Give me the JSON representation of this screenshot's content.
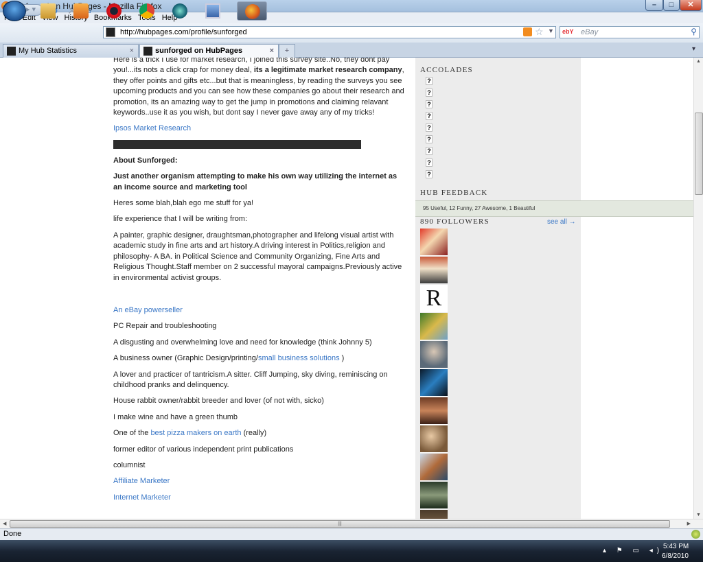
{
  "window": {
    "title": "sunforged on HubPages - Mozilla Firefox",
    "min_label": "–",
    "max_label": "□",
    "close_label": "✕"
  },
  "menu": [
    "File",
    "Edit",
    "View",
    "History",
    "Bookmarks",
    "Tools",
    "Help"
  ],
  "nav": {
    "url": "http://hubpages.com/profile/sunforged",
    "search_placeholder": "eBay",
    "search_engine": "ebY"
  },
  "tabs": [
    {
      "label": "My Hub Statistics",
      "active": false
    },
    {
      "label": "sunforged on HubPages",
      "active": true
    }
  ],
  "profile": {
    "intro_a": "Here is a trick I use for market research, I joined this survey site..No, they dont pay you!...its nots a click crap for money deal, ",
    "intro_bold": "its a legitimate market research company",
    "intro_b": ", they offer points and gifts etc...but that is meaningless, by reading the surveys you see upcoming products and you can see how these companies go about their research and promotion, its an amazing way to get the jump in promotions and claiming relavant keywords..use it as you wish, but dont say I never gave away any of my tricks!",
    "ipsos_link": "Ipsos Market Research",
    "about_heading": "About Sunforged:",
    "tagline": "Just another organism attempting to make his own way utilizing the internet as an income source and marketing tool",
    "blah": "Heres some blah,blah ego me stuff for ya!",
    "experience": "life experience that I will be writing from:",
    "bio": "A painter, graphic designer, draughtsman,photographer and lifelong visual artist with academic study in fine arts and art history.A driving interest in Politics,religion and philosophy- A BA. in Political Science and Community Organizing, Fine Arts and Religious Thought.Staff member on 2 successful mayoral campaigns.Previously active in environmental activist groups.",
    "ebay_link": "An eBay powerseller",
    "pc_repair": "PC Repair and troubleshooting",
    "knowledge": "A disgusting and overwhelming love and need for knowledge (think Johnny 5)",
    "business_a": "A business owner (Graphic Design/printing/",
    "business_link": "small business solutions",
    "business_b": " )",
    "tantric": "A lover and practicer of tantricism.A sitter. Cliff  Jumping, sky diving, reminiscing on childhood pranks and delinquency.",
    "rabbit": "House rabbit owner/rabbit breeder and lover (of not with, sicko)",
    "wine": "I make wine and have a green thumb",
    "pizza_a": "One of the ",
    "pizza_link": "best pizza makers on earth",
    "pizza_b": " (really)",
    "editor": "former editor of various independent print publications",
    "columnist": "columnist",
    "affiliate_link": "Affiliate Marketer",
    "internet_link": "Internet Marketer"
  },
  "sidebar": {
    "accolades_heading": "ACCOLADES",
    "accolade_glyph": "?",
    "feedback_heading": "HUB FEEDBACK",
    "feedback_text": "95 Useful, 12 Funny, 27 Awesome, 1 Beautiful",
    "followers_heading": "890 FOLLOWERS",
    "see_all": "see all →"
  },
  "status": {
    "text": "Done"
  },
  "clock": {
    "time": "5:43 PM",
    "date": "6/8/2010"
  },
  "colors": {
    "link": "#3a77c6",
    "sidebar_bg": "#ececec",
    "feedback_bg": "#e3e8df"
  }
}
